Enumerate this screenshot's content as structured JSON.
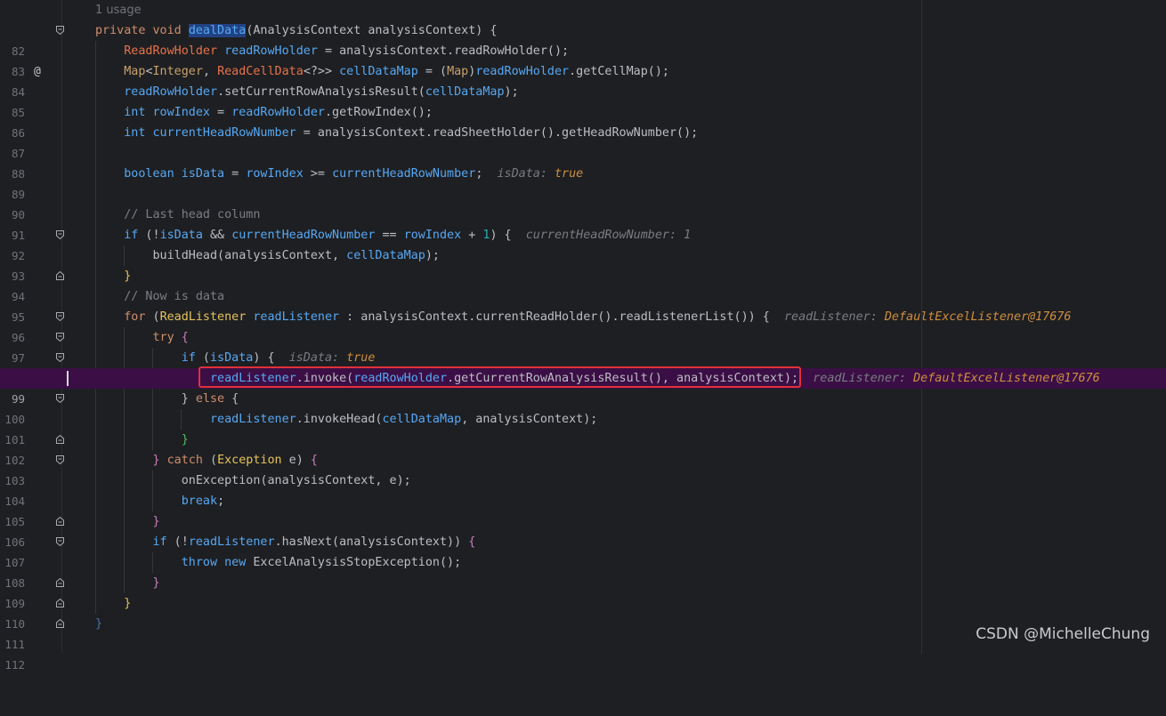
{
  "editor": {
    "usage_hint": "1 usage",
    "lines": [
      {
        "num": "82",
        "code": "private void dealData(AnalysisContext analysisContext) {"
      },
      {
        "num": "83",
        "code": "    ReadRowHolder readRowHolder = analysisContext.readRowHolder();"
      },
      {
        "num": "84",
        "code": "    Map<Integer, ReadCellData<?>> cellDataMap = (Map)readRowHolder.getCellMap();"
      },
      {
        "num": "85",
        "code": "    readRowHolder.setCurrentRowAnalysisResult(cellDataMap);"
      },
      {
        "num": "86",
        "code": "    int rowIndex = readRowHolder.getRowIndex();"
      },
      {
        "num": "87",
        "code": "    int currentHeadRowNumber = analysisContext.readSheetHolder().getHeadRowNumber();"
      },
      {
        "num": "88",
        "code": ""
      },
      {
        "num": "89",
        "code": "    boolean isData = rowIndex >= currentHeadRowNumber;",
        "hint_label": "isData:",
        "hint_value": "true"
      },
      {
        "num": "90",
        "code": ""
      },
      {
        "num": "91",
        "code": "    // Last head column"
      },
      {
        "num": "92",
        "code": "    if (!isData && currentHeadRowNumber == rowIndex + 1) {",
        "hint_label": "currentHeadRowNumber: 1"
      },
      {
        "num": "93",
        "code": "        buildHead(analysisContext, cellDataMap);"
      },
      {
        "num": "94",
        "code": "    }"
      },
      {
        "num": "95",
        "code": "    // Now is data"
      },
      {
        "num": "96",
        "code": "    for (ReadListener readListener : analysisContext.currentReadHolder().readListenerList()) {",
        "hint_label": "readListener:",
        "hint_value": "DefaultExcelListener@17676"
      },
      {
        "num": "97",
        "code": "        try {"
      },
      {
        "num": "98",
        "code": "            if (isData) {",
        "hint_label": "isData:",
        "hint_value": "true"
      },
      {
        "num": "99",
        "code": "                readListener.invoke(readRowHolder.getCurrentRowAnalysisResult(), analysisContext);",
        "hint_label": "readListener:",
        "hint_value": "DefaultExcelListener@17676"
      },
      {
        "num": "100",
        "code": "            } else {"
      },
      {
        "num": "101",
        "code": "                readListener.invokeHead(cellDataMap, analysisContext);"
      },
      {
        "num": "102",
        "code": "            }"
      },
      {
        "num": "103",
        "code": "        } catch (Exception e) {"
      },
      {
        "num": "104",
        "code": "            onException(analysisContext, e);"
      },
      {
        "num": "105",
        "code": "            break;"
      },
      {
        "num": "106",
        "code": "        }"
      },
      {
        "num": "107",
        "code": "        if (!readListener.hasNext(analysisContext)) {"
      },
      {
        "num": "108",
        "code": "            throw new ExcelAnalysisStopException();"
      },
      {
        "num": "109",
        "code": "        }"
      },
      {
        "num": "110",
        "code": "    }"
      },
      {
        "num": "111",
        "code": "}"
      },
      {
        "num": "112",
        "code": ""
      }
    ]
  },
  "gutter": {
    "override_marker": "@"
  },
  "watermark": "CSDN @MichelleChung",
  "colors": {
    "background": "#1e1f22",
    "current_line": "#3b0f45",
    "highlight_border": "#e0303a",
    "keyword": "#cf8e6d",
    "method": "#56a8f5",
    "field": "#c77dbb",
    "comment": "#7a7e85",
    "hint_value": "#cf8e3e"
  }
}
